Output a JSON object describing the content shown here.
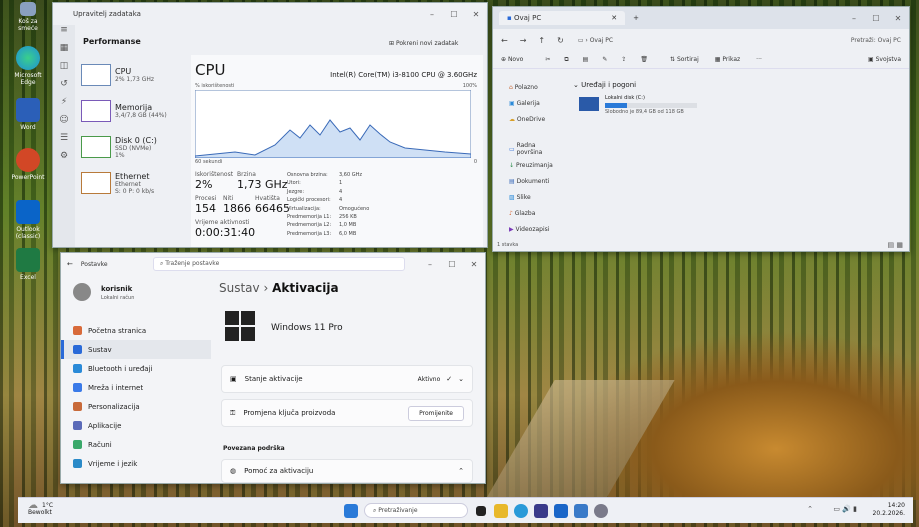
{
  "desktop": {
    "icons": [
      {
        "label": "Koš za smeće",
        "color": "#8aa0c0"
      },
      {
        "label": "Microsoft Edge",
        "color": "#1e8fd8"
      },
      {
        "label": "Word",
        "color": "#2b5fb8"
      },
      {
        "label": "PowerPoint",
        "color": "#d24726"
      },
      {
        "label": "Outlook (classic)",
        "color": "#0a64c8"
      },
      {
        "label": "Excel",
        "color": "#1f7a43"
      }
    ]
  },
  "task_manager": {
    "title": "Upravitelj zadataka",
    "section": "Performanse",
    "new_task_label": "Pokreni novi zadatak",
    "items": [
      {
        "name": "CPU",
        "sub": "2% 1,73 GHz"
      },
      {
        "name": "Memorija",
        "sub": "3,4/7,8 GB (44%)"
      },
      {
        "name": "Disk 0 (C:)",
        "sub": "SSD (NVMe)",
        "sub2": "1%"
      },
      {
        "name": "Ethernet",
        "sub": "Ethernet",
        "sub2": "S: 0 P: 0 kb/s"
      }
    ],
    "heading": "CPU",
    "model": "Intel(R) Core(TM) i3-8100 CPU @ 3.60GHz",
    "graph_label": "% iskorištenosti",
    "graph_max": "100%",
    "graph_time": "60 sekundi",
    "graph_min": "0",
    "stats": {
      "util_label": "Iskorištenost",
      "util": "2%",
      "speed_label": "Brzina",
      "speed": "1,73 GHz",
      "proc_label": "Procesi",
      "proc": "154",
      "threads_label": "Niti",
      "threads": "1866",
      "handles_label": "Hvatišta",
      "handles": "66465",
      "uptime_label": "Vrijeme aktivnosti",
      "uptime": "0:00:31:40"
    },
    "specs": [
      {
        "k": "Osnovna brzina:",
        "v": "3,60 GHz"
      },
      {
        "k": "Utori:",
        "v": "1"
      },
      {
        "k": "Jezgre:",
        "v": "4"
      },
      {
        "k": "Logički procesori:",
        "v": "4"
      },
      {
        "k": "Virtualizacija:",
        "v": "Omogućeno"
      },
      {
        "k": "Predmemorija L1:",
        "v": "256 KB"
      },
      {
        "k": "Predmemorija L2:",
        "v": "1,0 MB"
      },
      {
        "k": "Predmemorija L3:",
        "v": "6,0 MB"
      }
    ]
  },
  "explorer": {
    "tab_title": "Ovaj PC",
    "breadcrumb": "Ovaj PC",
    "search_placeholder": "Pretraži: Ovaj PC",
    "new_label": "Novo",
    "sort_label": "Sortiraj",
    "view_label": "Prikaz",
    "props_label": "Svojstva",
    "nav": [
      "Polazno",
      "Galerija",
      "OneDrive",
      "Radna površina",
      "Preuzimanja",
      "Dokumenti",
      "Slike",
      "Glazba",
      "Videozapisi"
    ],
    "group_title": "Uređaji i pogoni",
    "drive_name": "Lokalni disk (C:)",
    "drive_free": "Slobodno je 89,4 GB od 118 GB",
    "drive_used_fraction": 0.24,
    "status": "1 stavka"
  },
  "settings": {
    "title": "Postavke",
    "search_placeholder": "Traženje postavke",
    "user_name": "korisnik",
    "user_type": "Lokalni račun",
    "nav": [
      {
        "label": "Početna stranica",
        "color": "#d86a3a"
      },
      {
        "label": "Sustav",
        "color": "#2a6ad8"
      },
      {
        "label": "Bluetooth i uređaji",
        "color": "#2a8ad8"
      },
      {
        "label": "Mreža i internet",
        "color": "#3a7ae8"
      },
      {
        "label": "Personalizacija",
        "color": "#c86a3a"
      },
      {
        "label": "Aplikacije",
        "color": "#5a6ab8"
      },
      {
        "label": "Računi",
        "color": "#3aa86a"
      },
      {
        "label": "Vrijeme i jezik",
        "color": "#2a8ac8"
      }
    ],
    "breadcrumb_parent": "Sustav",
    "breadcrumb_sep": "›",
    "page_title": "Aktivacija",
    "edition": "Windows 11 Pro",
    "activation_label": "Stanje aktivacije",
    "activation_state": "Aktivno",
    "change_key_label": "Promjena ključa proizvoda",
    "change_button": "Promijenite",
    "related_label": "Povezana podrška",
    "help_label": "Pomoć za aktivaciju"
  },
  "taskbar": {
    "weather_temp": "1°C",
    "weather_desc": "Bewolkt",
    "search_placeholder": "Pretraživanje",
    "time": "14:20",
    "date": "20.2.2026."
  }
}
